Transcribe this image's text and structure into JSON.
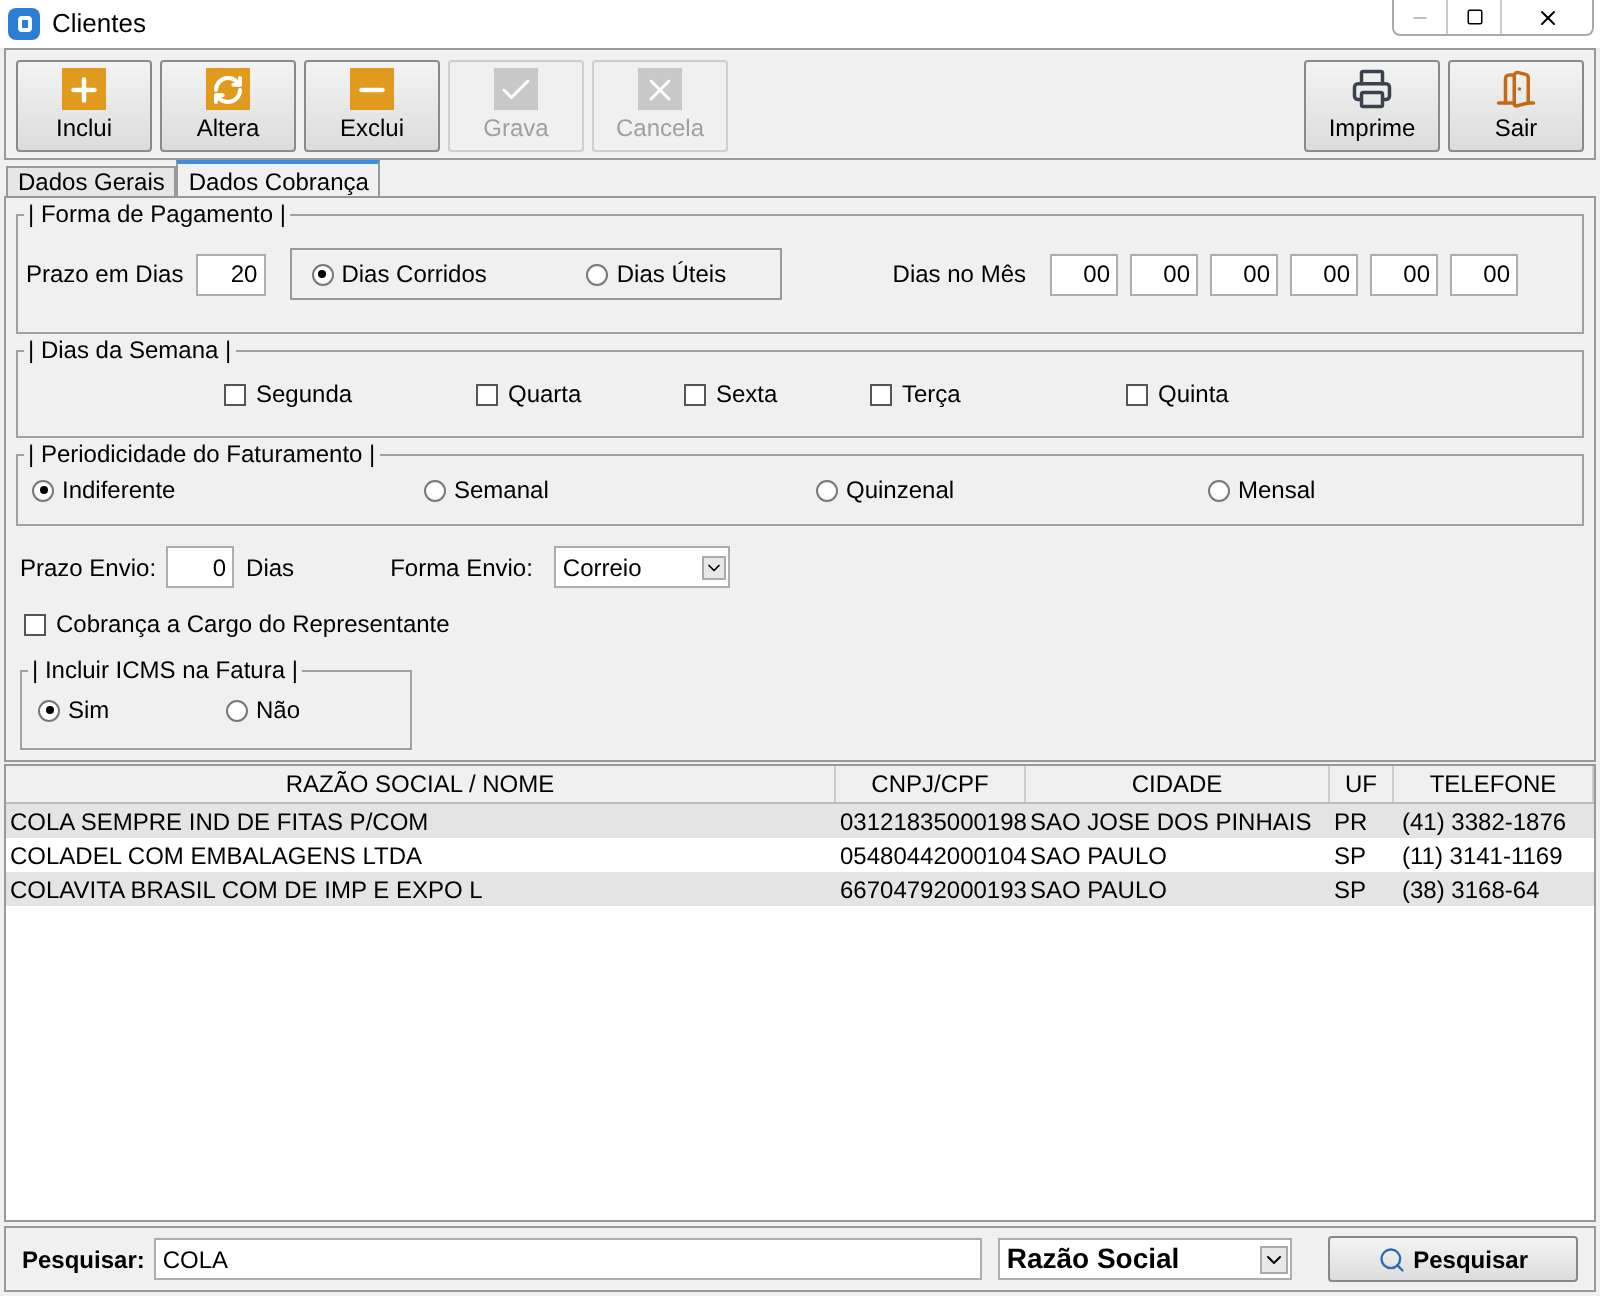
{
  "window": {
    "title": "Clientes"
  },
  "toolbar": {
    "left": [
      {
        "label": "Inclui",
        "kind": "add",
        "disabled": false
      },
      {
        "label": "Altera",
        "kind": "edit",
        "disabled": false
      },
      {
        "label": "Exclui",
        "kind": "remove",
        "disabled": false
      },
      {
        "label": "Grava",
        "kind": "save",
        "disabled": true
      },
      {
        "label": "Cancela",
        "kind": "cancel",
        "disabled": true
      }
    ],
    "right": [
      {
        "label": "Imprime",
        "kind": "print",
        "disabled": false
      },
      {
        "label": "Sair",
        "kind": "exit",
        "disabled": false
      }
    ]
  },
  "tabs": [
    {
      "label": "Dados Gerais",
      "selected": false
    },
    {
      "label": "Dados Cobrança",
      "selected": true
    }
  ],
  "forma_pagamento": {
    "title": "| Forma de Pagamento |",
    "prazo_label": "Prazo em Dias",
    "prazo_value": "20",
    "options": [
      {
        "label": "Dias Corridos",
        "selected": true
      },
      {
        "label": "Dias Úteis",
        "selected": false
      }
    ],
    "dias_mes_label": "Dias no Mês",
    "dias_mes": [
      "00",
      "00",
      "00",
      "00",
      "00",
      "00"
    ]
  },
  "dias_semana": {
    "title": "| Dias da Semana |",
    "days": [
      {
        "label": "Segunda",
        "checked": false
      },
      {
        "label": "Quarta",
        "checked": false
      },
      {
        "label": "Sexta",
        "checked": false
      },
      {
        "label": "Terça",
        "checked": false
      },
      {
        "label": "Quinta",
        "checked": false
      }
    ]
  },
  "periodicidade": {
    "title": "| Periodicidade do Faturamento |",
    "options": [
      {
        "label": "Indiferente",
        "selected": true
      },
      {
        "label": "Semanal",
        "selected": false
      },
      {
        "label": "Quinzenal",
        "selected": false
      },
      {
        "label": "Mensal",
        "selected": false
      }
    ]
  },
  "envio": {
    "prazo_label": "Prazo Envio:",
    "prazo_value": "0",
    "prazo_unit": "Dias",
    "forma_label": "Forma Envio:",
    "forma_value": "Correio"
  },
  "cobranca_representante": {
    "label": "Cobrança a Cargo do Representante",
    "checked": false
  },
  "icms": {
    "title": "| Incluir ICMS na Fatura |",
    "options": [
      {
        "label": "Sim",
        "selected": true
      },
      {
        "label": "Não",
        "selected": false
      }
    ]
  },
  "table": {
    "columns": [
      "RAZÃO SOCIAL / NOME",
      "CNPJ/CPF",
      "CIDADE",
      "UF",
      "TELEFONE"
    ],
    "rows": [
      [
        "COLA SEMPRE IND DE FITAS P/COM",
        "03121835000198",
        "SAO JOSE DOS PINHAIS",
        "PR",
        "(41) 3382-1876"
      ],
      [
        "COLADEL COM EMBALAGENS LTDA",
        "05480442000104",
        "SAO PAULO",
        "SP",
        "(11) 3141-1169"
      ],
      [
        "COLAVITA BRASIL COM DE IMP E EXPO L",
        "66704792000193",
        "SAO PAULO",
        "SP",
        "(38) 3168-64"
      ]
    ]
  },
  "search": {
    "label": "Pesquisar:",
    "value": "COLA",
    "field": "Razão Social",
    "button": "Pesquisar"
  }
}
